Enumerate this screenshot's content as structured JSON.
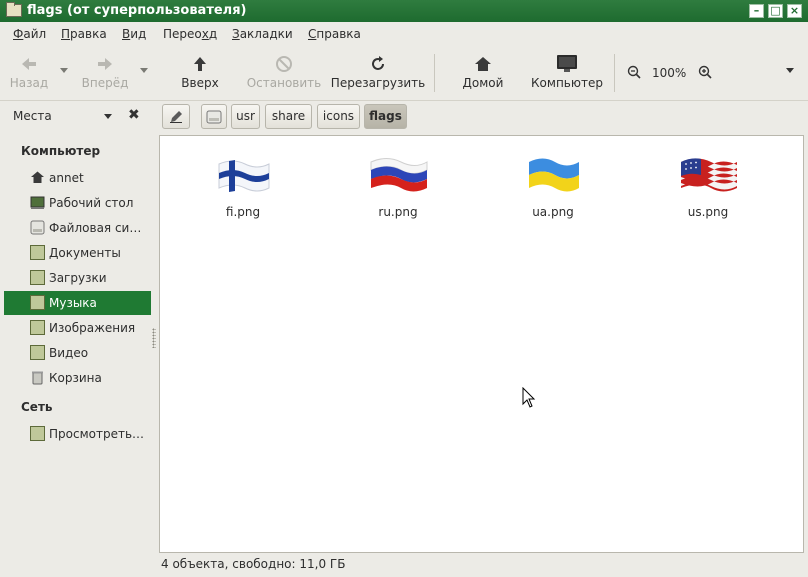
{
  "window": {
    "title": "flags (от суперпользователя)"
  },
  "menu": [
    {
      "label": "Файл",
      "accel": "Ф",
      "rest": "айл"
    },
    {
      "label": "Правка",
      "accel": "П",
      "rest": "равка"
    },
    {
      "label": "Вид",
      "accel": "В",
      "rest": "ид"
    },
    {
      "label": "Переход",
      "accel": "х",
      "pre": "Перео",
      "post": "д"
    },
    {
      "label": "Закладки",
      "accel": "З",
      "rest": "акладки"
    },
    {
      "label": "Справка",
      "accel": "С",
      "rest": "правка"
    }
  ],
  "toolbar": {
    "back": "Назад",
    "forward": "Вперёд",
    "up": "Вверх",
    "stop": "Остановить",
    "reload": "Перезагрузить",
    "home": "Домой",
    "computer": "Компьютер",
    "zoom": "100%"
  },
  "location": {
    "places_label": "Места",
    "path": [
      "usr",
      "share",
      "icons",
      "flags"
    ]
  },
  "sidebar": {
    "computer_header": "Компьютер",
    "network_header": "Сеть",
    "items": [
      {
        "label": "annet",
        "icon": "home-icon"
      },
      {
        "label": "Рабочий стол",
        "icon": "desktop-icon"
      },
      {
        "label": "Файловая си…",
        "icon": "drive-icon"
      },
      {
        "label": "Документы",
        "icon": "folder-icon"
      },
      {
        "label": "Загрузки",
        "icon": "folder-icon"
      },
      {
        "label": "Музыка",
        "icon": "folder-icon",
        "selected": true
      },
      {
        "label": "Изображения",
        "icon": "folder-icon"
      },
      {
        "label": "Видео",
        "icon": "folder-icon"
      },
      {
        "label": "Корзина",
        "icon": "trash-icon"
      }
    ],
    "network_items": [
      {
        "label": "Просмотреть…",
        "icon": "network-folder-icon"
      }
    ]
  },
  "files": [
    {
      "name": "fi.png",
      "flag": "finland"
    },
    {
      "name": "ru.png",
      "flag": "russia"
    },
    {
      "name": "ua.png",
      "flag": "ukraine"
    },
    {
      "name": "us.png",
      "flag": "usa"
    }
  ],
  "status": "4 объекта, свободно: 11,0 ГБ",
  "colors": {
    "titlebar": "#1e6b2f",
    "selection": "#1f7a33"
  }
}
